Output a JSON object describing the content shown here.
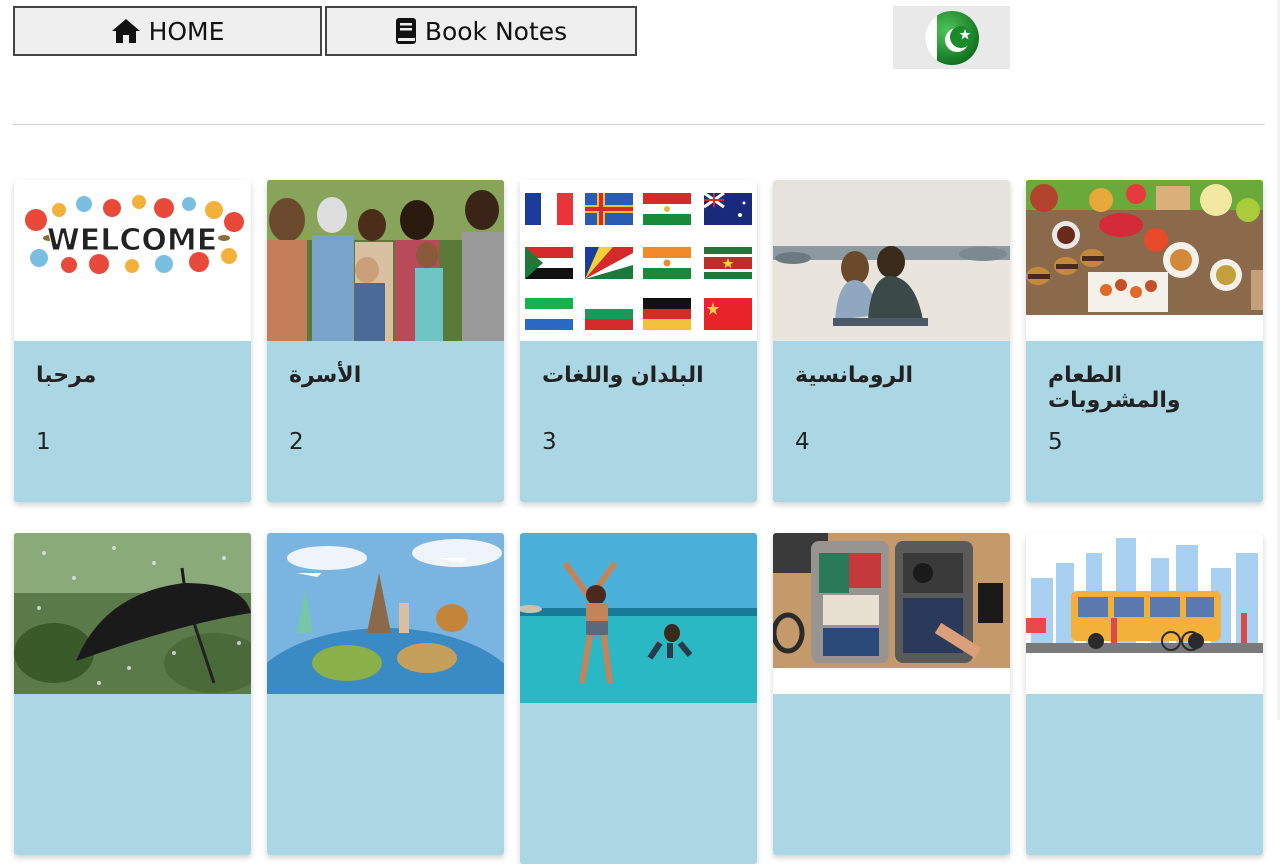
{
  "nav": {
    "home_label": "HOME",
    "notes_label": "Book Notes"
  },
  "language_flag": {
    "icon": "pakistan-flag-icon"
  },
  "lessons": [
    {
      "title": "مرحبا",
      "number": "1",
      "image_text": "WELCOME"
    },
    {
      "title": "الأسرة",
      "number": "2"
    },
    {
      "title": "البلدان واللغات",
      "number": "3"
    },
    {
      "title": "الرومانسية",
      "number": "4"
    },
    {
      "title": "الطعام والمشروبات",
      "number": "5"
    },
    {
      "title": "",
      "number": ""
    },
    {
      "title": "",
      "number": ""
    },
    {
      "title": "",
      "number": ""
    },
    {
      "title": "",
      "number": ""
    },
    {
      "title": "",
      "number": ""
    }
  ],
  "colors": {
    "card_info_bg": "#abd7e5",
    "button_bg": "#efefef"
  }
}
